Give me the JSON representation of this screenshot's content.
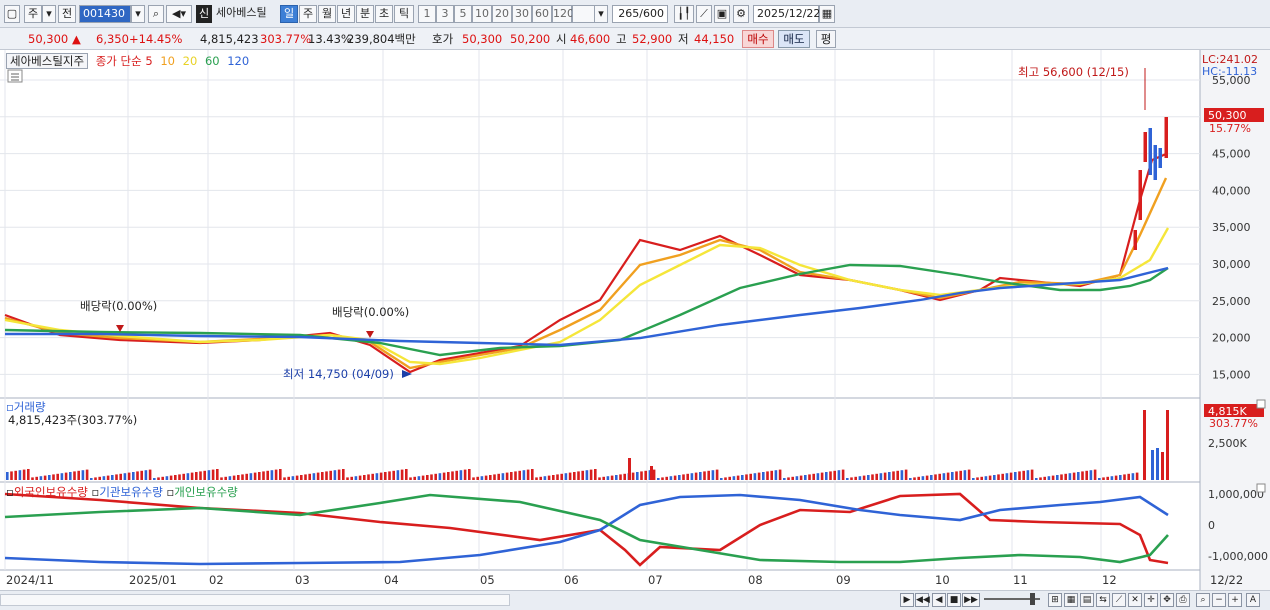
{
  "toolbar": {
    "type_label": "주",
    "mode_label": "전",
    "code": "001430",
    "sin_label": "신",
    "stock_name": "세아베스틸",
    "period_tabs": [
      "일",
      "주",
      "월",
      "년",
      "분",
      "초",
      "틱"
    ],
    "active_period": "일",
    "interval_buttons": [
      "1",
      "3",
      "5",
      "10",
      "20",
      "30",
      "60",
      "120"
    ],
    "count_value": "265",
    "count_total": "/600",
    "date": "2025/12/22"
  },
  "info": {
    "price": "50,300",
    "change_arrow": "▲",
    "change": "6,350",
    "change_pct": "+14.45%",
    "volume": "4,815,423",
    "volume_ratio": "303.77%",
    "turnover": "13.43%",
    "amount": "239,804백만",
    "quote_label": "호가",
    "ask": "50,300",
    "bid": "50,200",
    "open_label": "시",
    "open": "46,600",
    "high_label": "고",
    "high": "52,900",
    "low_label": "저",
    "low": "44,150",
    "buy_label": "매수",
    "sell_label": "매도",
    "avg_label": "평"
  },
  "price_panel": {
    "legend_name": "세아베스틸지주",
    "ma_label": "종가 단순",
    "ma_periods": [
      "5",
      "10",
      "20",
      "60",
      "120"
    ],
    "ma_colors": [
      "#d81e1e",
      "#f0a020",
      "#f5e63a",
      "#2aa050",
      "#2f63d6"
    ],
    "lc": "LC:241.02",
    "hc": "HC:-11.13",
    "max_note": "최고 56,600 (12/15)",
    "min_note": "최저 14,750 (04/09)",
    "dividend_1": "배당락(0.00%)",
    "dividend_2": "배당락(0.00%)",
    "current_price_tag": "50,300",
    "current_pct_tag": "15.77%",
    "y_ticks": [
      "55,000",
      "50,000",
      "45,000",
      "40,000",
      "35,000",
      "30,000",
      "25,000",
      "20,000",
      "15,000"
    ]
  },
  "volume_panel": {
    "title": "거래량",
    "value": "4,815,423주(303.77%)",
    "tag_value": "4,815K",
    "tag_pct": "303.77%",
    "y_tick": "2,500K"
  },
  "holding_panel": {
    "series": [
      "외국인보유수량",
      "기관보유수량",
      "개인보유수량"
    ],
    "colors": [
      "#d81e1e",
      "#2f63d6",
      "#2aa050"
    ],
    "y_ticks": [
      "1,000,000",
      "0",
      "-1,000,000"
    ]
  },
  "x_axis": {
    "labels": [
      "2024/11",
      "2025/01",
      "02",
      "03",
      "04",
      "05",
      "06",
      "07",
      "08",
      "09",
      "10",
      "11",
      "12"
    ],
    "right_label": "12/22"
  },
  "bottom_controls": [
    "▶",
    "◀◀",
    "◀",
    "■",
    "▶▶"
  ],
  "zoom_minus": "−",
  "zoom_plus": "+",
  "font_label": "A"
}
